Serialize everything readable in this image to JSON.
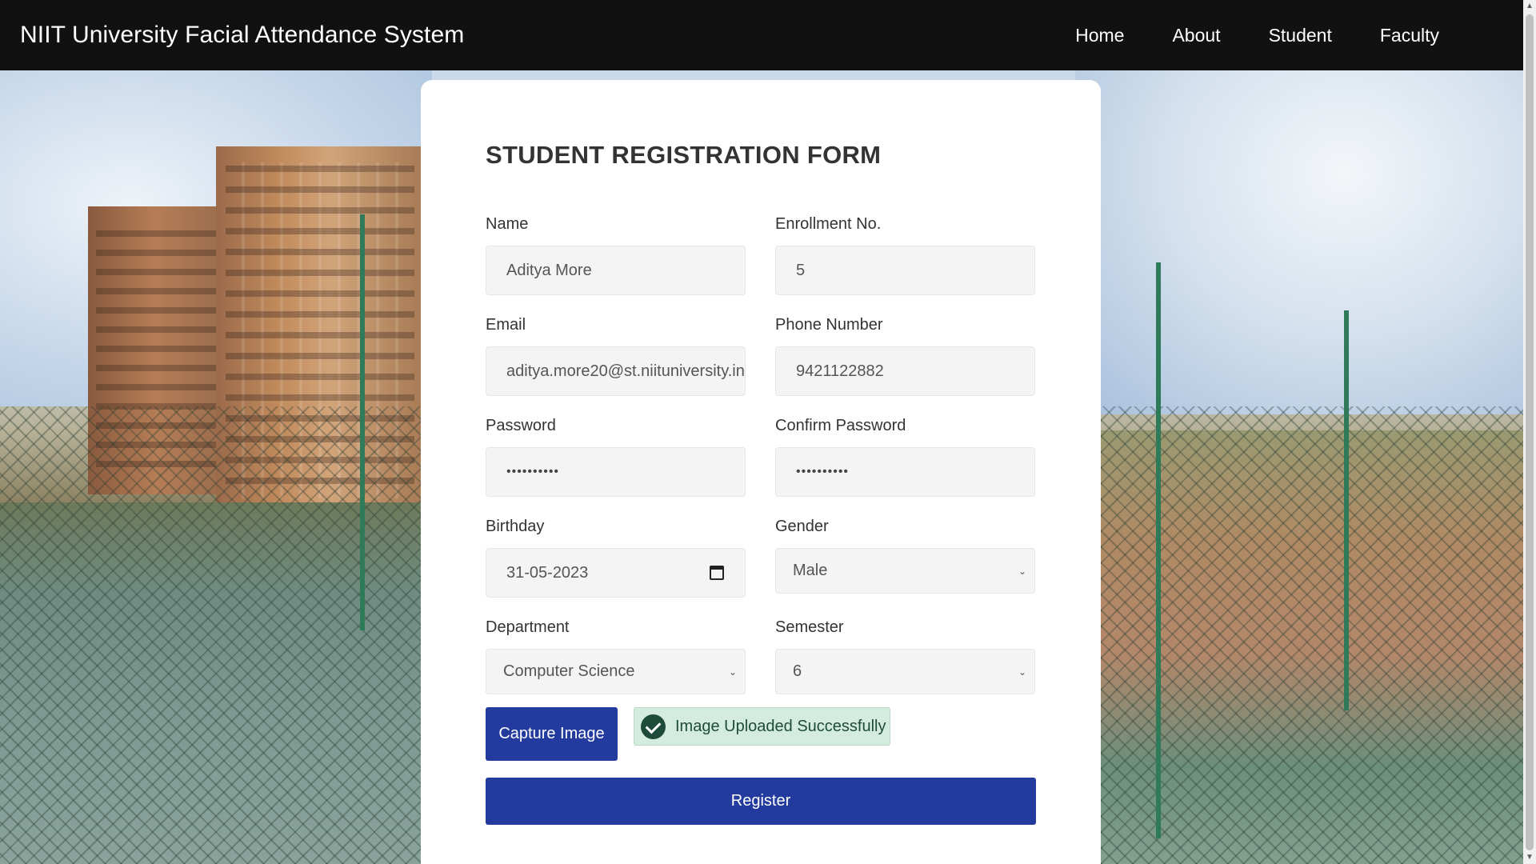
{
  "navbar": {
    "brand": "NIIT University Facial Attendance System",
    "links": [
      "Home",
      "About",
      "Student",
      "Faculty"
    ]
  },
  "form": {
    "title": "STUDENT REGISTRATION FORM",
    "name": {
      "label": "Name",
      "value": "Aditya More"
    },
    "enrollment": {
      "label": "Enrollment No.",
      "value": "5"
    },
    "email": {
      "label": "Email",
      "value": "aditya.more20@st.niituniversity.in"
    },
    "phone": {
      "label": "Phone Number",
      "value": "9421122882"
    },
    "password": {
      "label": "Password",
      "value": "••••••••••"
    },
    "confirm_password": {
      "label": "Confirm Password",
      "value": "••••••••••"
    },
    "birthday": {
      "label": "Birthday",
      "value": "31-05-2023"
    },
    "gender": {
      "label": "Gender",
      "value": "Male"
    },
    "department": {
      "label": "Department",
      "value": "Computer Science"
    },
    "semester": {
      "label": "Semester",
      "value": "6"
    },
    "capture_label": "Capture Image",
    "upload_status": "Image Uploaded Successfully",
    "register_label": "Register"
  },
  "icons": {
    "calendar": "calendar-icon",
    "check": "check-circle-icon",
    "dropdown": "chevron-down-icon"
  },
  "colors": {
    "navbar_bg": "#111111",
    "primary_button": "#233b9f",
    "success_bg": "#d4ecdf",
    "success_icon": "#1f4b3b"
  }
}
